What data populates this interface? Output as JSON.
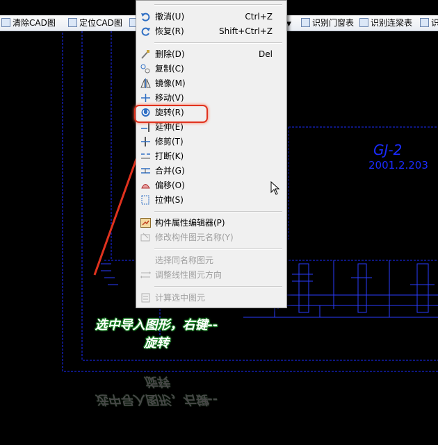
{
  "toolbar": {
    "items": [
      {
        "label": "清除CAD图",
        "icon": "clear-cad-icon"
      },
      {
        "label": "定位CAD图",
        "icon": "locate-cad-icon"
      },
      {
        "label": "识别门窗表",
        "icon": "door-window-table-icon"
      },
      {
        "label": "识别连梁表",
        "icon": "coupling-beam-table-icon"
      },
      {
        "label": "识",
        "icon": "recognize-icon"
      }
    ]
  },
  "menu": {
    "items": [
      {
        "label": "撤消(U)",
        "shortcut": "Ctrl+Z",
        "icon": "undo-icon"
      },
      {
        "label": "恢复(R)",
        "shortcut": "Shift+Ctrl+Z",
        "icon": "redo-icon"
      },
      {
        "label": "删除(D)",
        "shortcut": "Del",
        "icon": "delete-icon"
      },
      {
        "label": "复制(C)",
        "shortcut": "",
        "icon": "copy-icon"
      },
      {
        "label": "镜像(M)",
        "shortcut": "",
        "icon": "mirror-icon"
      },
      {
        "label": "移动(V)",
        "shortcut": "",
        "icon": "move-icon"
      },
      {
        "label": "旋转(R)",
        "shortcut": "",
        "icon": "rotate-icon"
      },
      {
        "label": "延伸(E)",
        "shortcut": "",
        "icon": "extend-icon"
      },
      {
        "label": "修剪(T)",
        "shortcut": "",
        "icon": "trim-icon"
      },
      {
        "label": "打断(K)",
        "shortcut": "",
        "icon": "break-icon"
      },
      {
        "label": "合并(G)",
        "shortcut": "",
        "icon": "merge-icon"
      },
      {
        "label": "偏移(O)",
        "shortcut": "",
        "icon": "offset-icon"
      },
      {
        "label": "拉伸(S)",
        "shortcut": "",
        "icon": "stretch-icon"
      },
      {
        "label": "构件属性编辑器(P)",
        "shortcut": "",
        "icon": "property-editor-icon"
      },
      {
        "label": "修改构件图元名称(Y)",
        "shortcut": "",
        "icon": "rename-element-icon",
        "disabled": true
      },
      {
        "label": "选择同名称图元",
        "shortcut": "",
        "icon": "",
        "disabled": true
      },
      {
        "label": "调整线性图元方向",
        "shortcut": "",
        "icon": "adjust-direction-icon",
        "disabled": true
      },
      {
        "label": "计算选中图元",
        "shortcut": "",
        "icon": "calculate-icon",
        "disabled": true
      }
    ]
  },
  "cad": {
    "label_code": "GJ-2",
    "label_sub": "2001.2.203"
  },
  "caption": {
    "line1": "选中导入图形，右键--",
    "line2": "旋转"
  },
  "colors": {
    "cad_line": "#1a2bff",
    "annotation_red": "#e0321e",
    "caption_outline": "#1e8a2a"
  }
}
